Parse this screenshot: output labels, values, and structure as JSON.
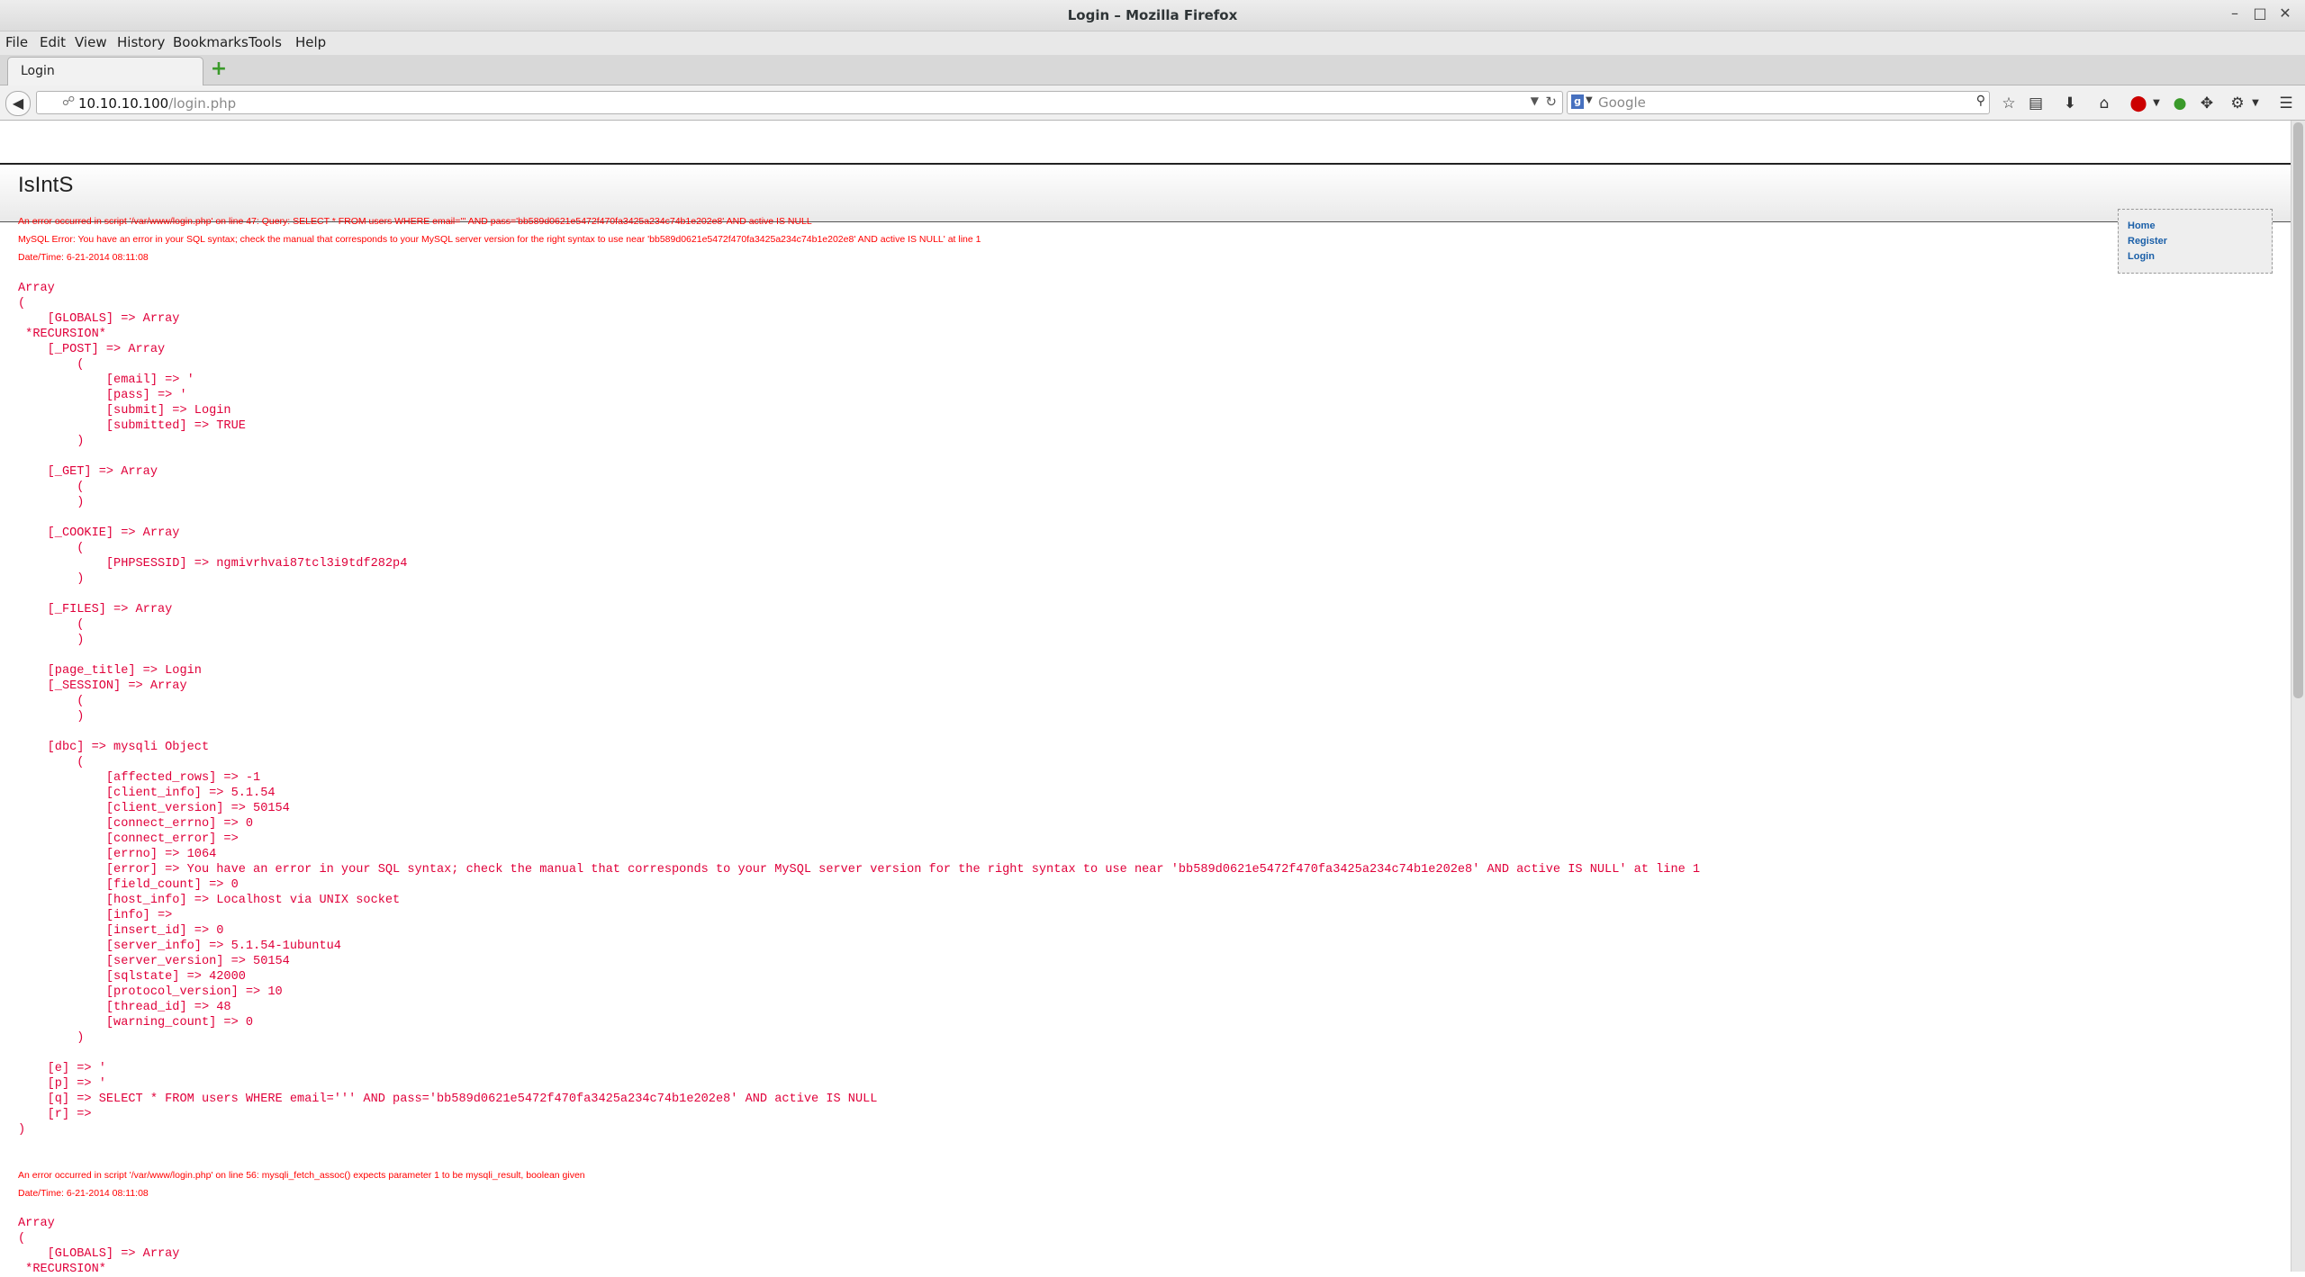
{
  "window": {
    "title": "Login – Mozilla Firefox",
    "min": "–",
    "max": "□",
    "close": "✕"
  },
  "menubar": [
    "File",
    "Edit",
    "View",
    "History",
    "Bookmarks",
    "Tools",
    "Help"
  ],
  "tab": {
    "label": "Login",
    "new_tab": "+"
  },
  "navbar": {
    "back": "◀",
    "url_host": "10.10.10.100",
    "url_path": "/login.php",
    "search_placeholder": "Google",
    "search_engine_icon": "google-icon"
  },
  "page": {
    "site_title": "IsIntS",
    "errors": [
      {
        "line1": "An error occurred in script '/var/www/login.php' on line 47: Query: SELECT * FROM users WHERE email=''' AND pass='bb589d0621e5472f470fa3425a234c74b1e202e8' AND active IS NULL",
        "line2": "MySQL Error: You have an error in your SQL syntax; check the manual that corresponds to your MySQL server version for the right syntax to use near 'bb589d0621e5472f470fa3425a234c74b1e202e8' AND active IS NULL' at line 1",
        "datetime": "Date/Time: 6-21-2014 08:11:08"
      },
      {
        "line1": "An error occurred in script '/var/www/login.php' on line 56: mysqli_fetch_assoc() expects parameter 1 to be mysqli_result, boolean given",
        "datetime": "Date/Time: 6-21-2014 08:11:08"
      }
    ],
    "dump1": "Array\n(\n    [GLOBALS] => Array\n *RECURSION*\n    [_POST] => Array\n        (\n            [email] => '\n            [pass] => '\n            [submit] => Login\n            [submitted] => TRUE\n        )\n\n    [_GET] => Array\n        (\n        )\n\n    [_COOKIE] => Array\n        (\n            [PHPSESSID] => ngmivrhvai87tcl3i9tdf282p4\n        )\n\n    [_FILES] => Array\n        (\n        )\n\n    [page_title] => Login\n    [_SESSION] => Array\n        (\n        )\n\n    [dbc] => mysqli Object\n        (\n            [affected_rows] => -1\n            [client_info] => 5.1.54\n            [client_version] => 50154\n            [connect_errno] => 0\n            [connect_error] => \n            [errno] => 1064\n            [error] => You have an error in your SQL syntax; check the manual that corresponds to your MySQL server version for the right syntax to use near 'bb589d0621e5472f470fa3425a234c74b1e202e8' AND active IS NULL' at line 1\n            [field_count] => 0\n            [host_info] => Localhost via UNIX socket\n            [info] => \n            [insert_id] => 0\n            [server_info] => 5.1.54-1ubuntu4\n            [server_version] => 50154\n            [sqlstate] => 42000\n            [protocol_version] => 10\n            [thread_id] => 48\n            [warning_count] => 0\n        )\n\n    [e] => '\n    [p] => '\n    [q] => SELECT * FROM users WHERE email=''' AND pass='bb589d0621e5472f470fa3425a234c74b1e202e8' AND active IS NULL\n    [r] => \n)",
    "dump2": "Array\n(\n    [GLOBALS] => Array\n *RECURSION*"
  },
  "sidebar": {
    "links": [
      "Home",
      "Register",
      "Login"
    ]
  },
  "colors": {
    "error": "#ff0000",
    "dump": "#e0003a",
    "link": "#1a5fa8"
  }
}
